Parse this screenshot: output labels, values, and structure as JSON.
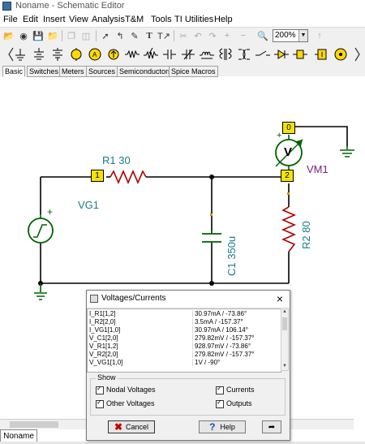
{
  "window": {
    "title": "Noname - Schematic Editor"
  },
  "menu": [
    "File",
    "Edit",
    "Insert",
    "View",
    "Analysis",
    "T&M",
    "Tools",
    "TI Utilities",
    "Help"
  ],
  "toolbar": {
    "zoom": "200%"
  },
  "component_tabs": [
    "Basic",
    "Switches",
    "Meters",
    "Sources",
    "Semiconductors",
    "Spice Macros"
  ],
  "schematic": {
    "r1_label": "R1 30",
    "r2_label": "R2 80",
    "c1_label": "C1 350u",
    "vg1_label": "VG1",
    "vm1_label": "VM1",
    "vm1_symbol": "V",
    "node1": "1",
    "node2": "2",
    "node0": "0",
    "colors": {
      "wire": "#000000",
      "component": "#b00000",
      "label": "#1a7a8a",
      "node_box": "#f5e400"
    }
  },
  "dialog": {
    "title": "Voltages/Currents",
    "rows": [
      {
        "name": "I_R1[1,2]",
        "value": "30.97mA / -73.86°"
      },
      {
        "name": "I_R2[2,0]",
        "value": "3.5mA / -157.37°"
      },
      {
        "name": "I_VG1[1,0]",
        "value": "30.97mA / 106.14°"
      },
      {
        "name": "V_C1[2,0]",
        "value": "279.82mV / -157.37°"
      },
      {
        "name": "V_R1[1,2]",
        "value": "928.97mV / -73.86°"
      },
      {
        "name": "V_R2[2,0]",
        "value": "279.82mV / -157.37°"
      },
      {
        "name": "V_VG1[1,0]",
        "value": "1V / -90°"
      }
    ],
    "show_label": "Show",
    "checks": {
      "nodal": "Nodal Voltages",
      "other": "Other Voltages",
      "currents": "Currents",
      "outputs": "Outputs"
    },
    "cancel": "Cancel",
    "help": "Help"
  },
  "sheet_tab": "Noname"
}
